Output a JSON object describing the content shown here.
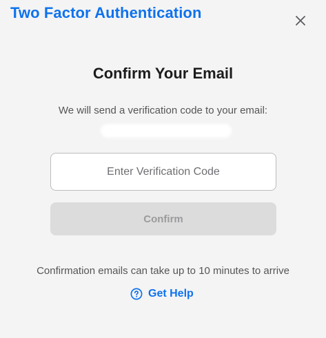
{
  "dialog": {
    "title": "Two Factor Authentication",
    "close_icon": "close-icon"
  },
  "content": {
    "heading": "Confirm Your Email",
    "description": "We will send a verification code to your email:",
    "code_input": {
      "placeholder": "Enter Verification Code",
      "value": ""
    },
    "confirm_label": "Confirm",
    "note": "Confirmation emails can take up to 10 minutes to arrive",
    "help": {
      "icon": "help-circle-icon",
      "label": "Get Help"
    }
  },
  "colors": {
    "accent": "#0e72ed",
    "background": "#f4f4f4",
    "disabled_button": "#dcdcdc",
    "disabled_text": "#9b9b9f"
  }
}
